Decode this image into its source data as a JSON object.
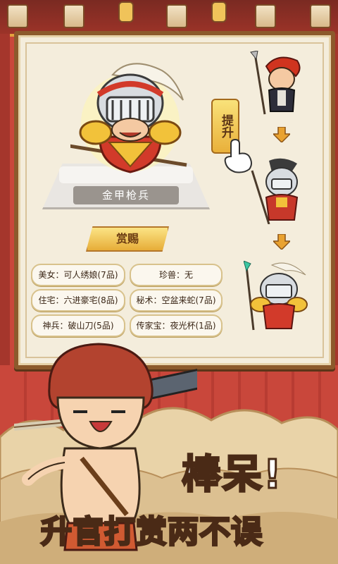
{
  "hero": {
    "name": "金甲枪兵"
  },
  "promote": {
    "label": "提升"
  },
  "reward": {
    "title": "赏赐",
    "items": [
      {
        "text": "美女：可人绣娘(7品)"
      },
      {
        "text": "珍兽：无"
      },
      {
        "text": "住宅：六进豪宅(8品)"
      },
      {
        "text": "秘术：空盆来蛇(7品)"
      },
      {
        "text": "神兵：破山刀(5品)"
      },
      {
        "text": "传家宝：夜光杯(1品)"
      }
    ]
  },
  "slogan": {
    "line1": "棒呆!",
    "line2": "升官打赏两不误"
  },
  "colors": {
    "wall_red": "#c9473b",
    "frame_brown": "#8c5a2c",
    "panel_cream": "#f4eddc",
    "gold": "#e9b03a",
    "slogan_outline": "#4a2a16"
  },
  "icons": [
    "lantern-icon",
    "arrow-down-icon",
    "pointing-hand-icon"
  ]
}
